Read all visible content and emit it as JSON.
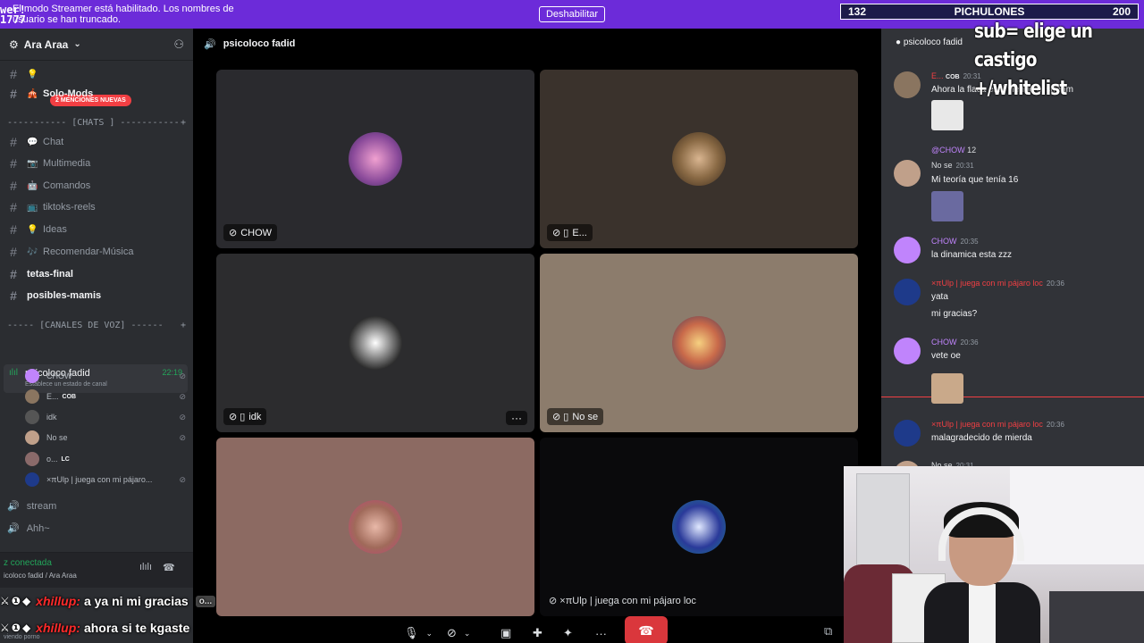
{
  "stream_overlay": {
    "corner_text": "wer!\n1777",
    "counter_left": "132",
    "counter_label": "PICHULONES",
    "counter_right": "200",
    "sub_text_1": "sub= elige un castigo",
    "sub_text_2": "+/whitelist"
  },
  "streamer_bar": {
    "message": "El modo Streamer está habilitado. Los nombres de usuario se han truncado.",
    "button": "Deshabilitar"
  },
  "server": {
    "name": "Ara Araa",
    "mention_badge": "2 MENCIONES NUEVAS",
    "channels_top": [
      {
        "label": "Solo-Mods"
      }
    ],
    "category_chats": "----------- [CHATS ] -----------",
    "chat_channels": [
      {
        "label": "Chat"
      },
      {
        "label": "Multimedia"
      },
      {
        "label": "Comandos"
      },
      {
        "label": "tiktoks-reels"
      },
      {
        "label": "Ideas"
      },
      {
        "label": "Recomendar-Música"
      },
      {
        "label": "tetas-final"
      },
      {
        "label": "posibles-mamis"
      }
    ],
    "category_voice": "----- [CANALES DE VOZ] ------",
    "voice_channel": {
      "name": "psicoloco fadid",
      "status": "Establece un estado de canal",
      "timer": "22:19"
    },
    "voice_users": [
      {
        "name": "CHOW",
        "tag": "",
        "color": "#c084fc"
      },
      {
        "name": "E...",
        "tag": "COB",
        "color": "#8a7560"
      },
      {
        "name": "idk",
        "tag": "",
        "color": "#555"
      },
      {
        "name": "No se",
        "tag": "",
        "color": "#c0a08a"
      },
      {
        "name": "o...",
        "tag": "LC",
        "color": "#8a6a6a"
      },
      {
        "name": "×πUlp | juega con mi pájaro...",
        "tag": "",
        "color": "#1e3a8a"
      }
    ],
    "other_voice": [
      "stream",
      "Ahh~"
    ],
    "connection_status": "z conectada",
    "connection_detail": "icoloco fadid / Ara Araa",
    "viewing": "viendo porno"
  },
  "call": {
    "title": "psicoloco fadid",
    "tiles": [
      {
        "label": "CHOW"
      },
      {
        "label": "E..."
      },
      {
        "label": "idk"
      },
      {
        "label": "No se"
      },
      {
        "label": ""
      },
      {
        "label": "×πUlp | juega con mi pájaro loc"
      }
    ],
    "bottom_more": "o..."
  },
  "chat": {
    "header": "psicoloco fadid",
    "messages": [
      {
        "author": "E...",
        "tag": "COB",
        "time": "20:31",
        "text": "Ahora la flaca está viendo el stream",
        "author_color": "#f23f43"
      },
      {
        "reply": "@CHOW",
        "reply_num": "12",
        "author": "No se",
        "time": "20:31",
        "text": "Mi teoría que tenía 16",
        "author_color": "#dbdee1"
      },
      {
        "author": "CHOW",
        "time": "20:35",
        "text": "la dinamica esta zzz",
        "author_color": "#c084fc"
      },
      {
        "author": "×πUlp | juega con mi pájaro loc",
        "time": "20:36",
        "text": "yata",
        "text2": "mi gracias?",
        "author_color": "#f23f43"
      },
      {
        "author": "CHOW",
        "time": "20:36",
        "text": "vete oe",
        "author_color": "#c084fc"
      },
      {
        "author": "×πUlp | juega con mi pájaro loc",
        "time": "20:36",
        "text": "malagradecido de mierda",
        "author_color": "#f23f43"
      },
      {
        "author": "No se",
        "time": "20:31",
        "text": "",
        "author_color": "#dbdee1"
      }
    ]
  },
  "twitch_chat": [
    {
      "user": "xhillup:",
      "text": "a ya ni mi gracias"
    },
    {
      "user": "xhillup:",
      "text": "ahora si te kgaste"
    }
  ]
}
